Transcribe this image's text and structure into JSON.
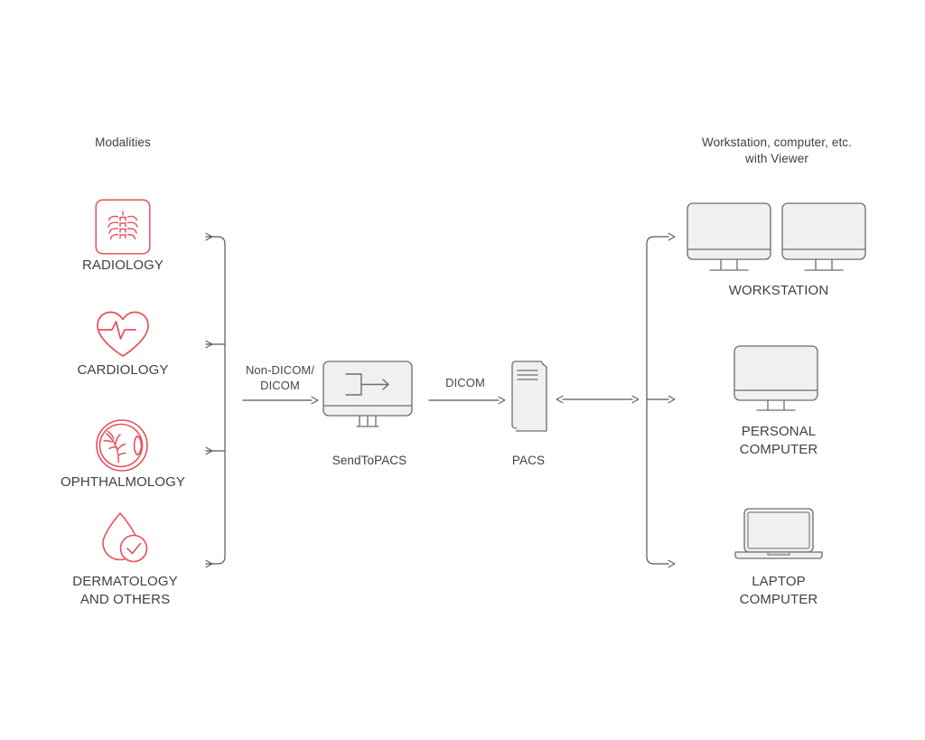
{
  "diagram": {
    "title_left": "Modalities",
    "title_right": "Workstation, computer, etc.\nwith Viewer",
    "accent_color": "#e8505b",
    "line_color": "#58585b",
    "text_color": "#414145",
    "screen_fill": "#f0f0f0",
    "background": "#ffffff"
  },
  "modalities": [
    {
      "label": "RADIOLOGY",
      "icon": "ribcage-xray-icon"
    },
    {
      "label": "CARDIOLOGY",
      "icon": "heart-pulse-icon"
    },
    {
      "label": "OPHTHALMOLOGY",
      "icon": "eye-anatomy-icon"
    },
    {
      "label": "DERMATOLOGY\nAND OTHERS",
      "icon": "droplet-check-icon"
    }
  ],
  "pipeline": {
    "edge_in_label": "Non-DICOM/\nDICOM",
    "sendtopacs": {
      "label": "SendToPACS",
      "icon": "merge-arrow-monitor-icon"
    },
    "edge_mid_label": "DICOM",
    "pacs": {
      "label": "PACS",
      "icon": "server-tower-icon"
    },
    "edge_out_label": ""
  },
  "endpoints": [
    {
      "label": "WORKSTATION",
      "icon": "dual-monitor-icon"
    },
    {
      "label": "PERSONAL\nCOMPUTER",
      "icon": "desktop-monitor-icon"
    },
    {
      "label": "LAPTOP\nCOMPUTER",
      "icon": "laptop-icon"
    }
  ]
}
